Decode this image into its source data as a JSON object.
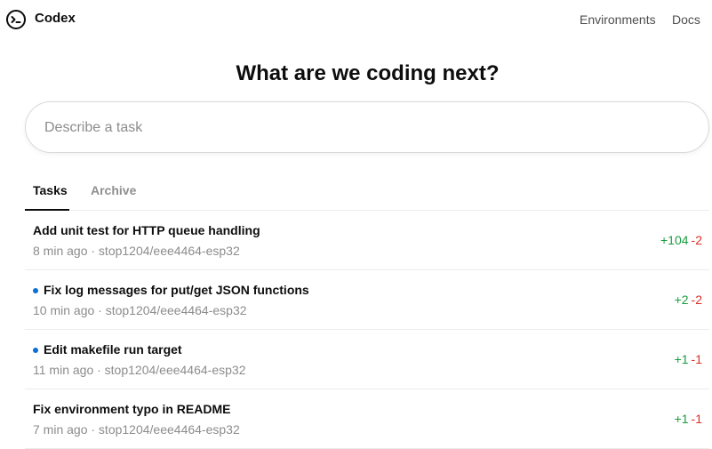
{
  "header": {
    "brand": "Codex",
    "nav": [
      {
        "label": "Environments"
      },
      {
        "label": "Docs"
      }
    ]
  },
  "heading": "What are we coding next?",
  "task_input": {
    "placeholder": "Describe a task",
    "value": ""
  },
  "tabs": [
    {
      "label": "Tasks",
      "active": true
    },
    {
      "label": "Archive",
      "active": false
    }
  ],
  "tasks": [
    {
      "title": "Add unit test for HTTP queue handling",
      "time": "8 min ago",
      "repo": "stop1204/eee4464-esp32",
      "meta": "8 min ago · stop1204/eee4464-esp32",
      "additions": "+104",
      "deletions": "-2",
      "unread": false
    },
    {
      "title": "Fix log messages for put/get JSON functions",
      "time": "10 min ago",
      "repo": "stop1204/eee4464-esp32",
      "meta": "10 min ago · stop1204/eee4464-esp32",
      "additions": "+2",
      "deletions": "-2",
      "unread": true
    },
    {
      "title": "Edit makefile run target",
      "time": "11 min ago",
      "repo": "stop1204/eee4464-esp32",
      "meta": "11 min ago · stop1204/eee4464-esp32",
      "additions": "+1",
      "deletions": "-1",
      "unread": true
    },
    {
      "title": "Fix environment typo in README",
      "time": "7 min ago",
      "repo": "stop1204/eee4464-esp32",
      "meta": "7 min ago · stop1204/eee4464-esp32",
      "additions": "+1",
      "deletions": "-1",
      "unread": false
    }
  ],
  "colors": {
    "additions": "#1a9c3e",
    "deletions": "#d93025",
    "unread_dot": "#0a6fd6"
  },
  "icons": {
    "logo": "codex-terminal-icon"
  }
}
